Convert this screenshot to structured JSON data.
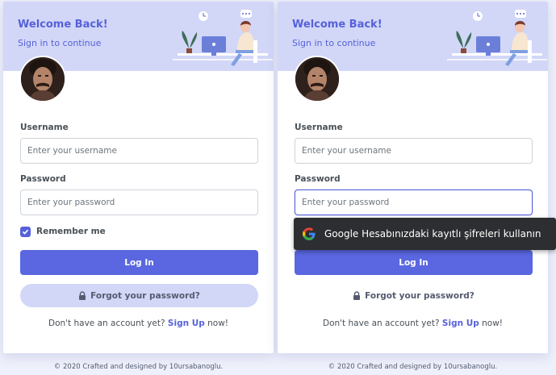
{
  "colors": {
    "accent": "#5661d9",
    "hero_bg": "#d2d7f8",
    "button": "#5a67e0",
    "tooltip_bg": "#2d2e31"
  },
  "cards": [
    {
      "title": "Welcome Back!",
      "subtitle": "Sign in to continue",
      "username_label": "Username",
      "username_placeholder": "Enter your username",
      "password_label": "Password",
      "password_placeholder": "Enter your password",
      "remember_label": "Remember me",
      "remember_checked": true,
      "login_label": "Log In",
      "forgot_label": "Forgot your password?",
      "signup_prefix": "Don't have an account yet?",
      "signup_link": "Sign Up",
      "signup_suffix": "now!",
      "footer": "© 2020 Crafted and designed by 10ursabanoglu."
    },
    {
      "title": "Welcome Back!",
      "subtitle": "Sign in to continue",
      "username_label": "Username",
      "username_placeholder": "Enter your username",
      "password_label": "Password",
      "password_placeholder": "Enter your password",
      "password_focused": true,
      "login_label": "Log In",
      "forgot_label": "Forgot your password?",
      "signup_prefix": "Don't have an account yet?",
      "signup_link": "Sign Up",
      "signup_suffix": "now!",
      "footer": "© 2020 Crafted and designed by 10ursabanoglu."
    }
  ],
  "autofill_tooltip": {
    "icon": "google-g-icon",
    "text": "Google Hesabınızdaki kayıtlı şifreleri kullanın"
  }
}
